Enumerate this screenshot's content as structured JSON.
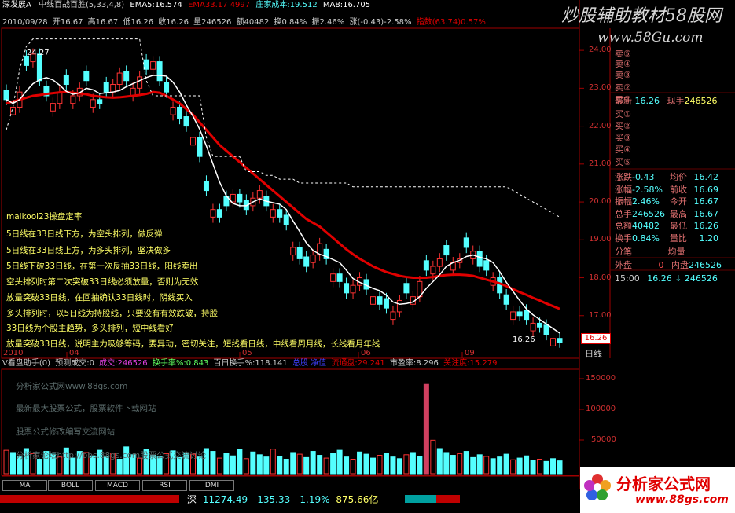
{
  "header": {
    "line1": {
      "stock": "深发展A",
      "indicator": "中线百战百胜",
      "params": "(5,33,4,8)",
      "ema5": "EMA5:16.574",
      "ema33": "EMA33.17",
      "ema33_tail": "4997",
      "dealer_cost": "庄家成本:19.512",
      "ma8": "MA8:16.705"
    },
    "line2": {
      "date": "2010/09/28",
      "open": "开16.67",
      "high": "高16.67",
      "low": "低16.26",
      "close": "收16.26",
      "volume": "量246526",
      "amount": "额40482",
      "turnover": "换0.84%",
      "amplitude": "振2.46%",
      "change": "涨(-0.43)-2.58%",
      "index": "指数(63.74)0.57%"
    }
  },
  "watermark_top": {
    "title": "炒股辅助教材58股网",
    "url": "www.58Gu.com"
  },
  "annotations": {
    "high_label": "24.27",
    "low_label": "16.26",
    "notes": [
      "maikool23操盘定率",
      "5日线在33日线下方，为空头排列，做反弹",
      "5日线在33日线上方，为多头排列，坚决做多",
      "5日线下破33日线，在第一次反抽33日线，阳线卖出",
      "空头排列时第二次突破33日线必须放量，否则为无效",
      "放量突破33日线，在回抽确认33日线时，阴线买入",
      "多头排列时，以5日线为持股线，只要没有有效跌破，持股",
      "33日线为个股主趋势，多头排列，短中线看好",
      "放量突破33日线，说明主力吸够筹码，要异动，密切关注，短线看日线，中线看周月线，长线看月年线"
    ]
  },
  "price_axis": [
    "24.00",
    "23.00",
    "22.00",
    "21.00",
    "20.00",
    "19.00",
    "18.00",
    "17.00"
  ],
  "current_price_tag": "16.26",
  "x_axis": [
    "2010",
    "04",
    "05",
    "06",
    "09"
  ],
  "period": "日线",
  "order_book": {
    "asks": [
      "卖④",
      "卖③",
      "卖②",
      "卖①"
    ],
    "ask5": "卖⑤",
    "latest_label": "最新",
    "latest_value": "16.26",
    "current_hand_label": "现手",
    "current_hand_value": "246526",
    "bids": [
      "买①",
      "买②",
      "买③",
      "买④",
      "买⑤"
    ],
    "stats": [
      {
        "l1": "涨跌",
        "v1": "-0.43",
        "l2": "均价",
        "v2": "16.42"
      },
      {
        "l1": "涨幅",
        "v1": "-2.58%",
        "l2": "前收",
        "v2": "16.69"
      },
      {
        "l1": "振幅",
        "v1": "2.46%",
        "l2": "今开",
        "v2": "16.67"
      },
      {
        "l1": "总手",
        "v1": "246526",
        "l2": "最高",
        "v2": "16.67"
      },
      {
        "l1": "总额",
        "v1": "40482",
        "l2": "最低",
        "v2": "16.26"
      },
      {
        "l1": "换手",
        "v1": "0.84%",
        "l2": "量比",
        "v2": "1.20"
      }
    ],
    "row_fenbi": "分笔",
    "row_junliang": "均量",
    "outer_label": "外盘",
    "outer_value": "0",
    "inner_label": "内盘",
    "inner_value": "246526",
    "trade_time": "15:00",
    "trade_price": "16.26",
    "trade_arrow": "↓",
    "trade_vol": "246526"
  },
  "volume_header": {
    "name": "V看盘助手(0)",
    "predict": "预测成交:0",
    "turnover": "成交:246526",
    "turnover_rate": "换手率%:0.843",
    "hundred_day": "百日换手%:118.141",
    "float_cap": "流通盘:29.241",
    "pe": "市盈率:8.296",
    "attention": "关注度:15.279",
    "label_a": "总股",
    "label_b": "净值"
  },
  "volume_axis": [
    "150000",
    "100000",
    "50000"
  ],
  "volume_watermarks": [
    "分析家公式网www.88gs.com",
    "最新最大股票公式，股票软件下载网站",
    "股票公式修改编写交流网站",
    "分析家论坛http://bbs.88gs.com股票公式交流讨论"
  ],
  "tabs": [
    "MA",
    "BOLL",
    "MACD",
    "RSI",
    "DMI"
  ],
  "status_bar": {
    "market": "深",
    "index_value": "11274.49",
    "change": "-135.33",
    "pct": "-1.19%",
    "amount": "875.66亿"
  },
  "logo": {
    "text": "分析家公式网",
    "url": "www.88gs.com"
  },
  "colors": {
    "up": "#ff3333",
    "down": "#54ffff",
    "ma33": "#e00000",
    "axis": "#a00000",
    "yellow": "#ffff66"
  },
  "chart_data": {
    "type": "candlestick",
    "ylim": [
      16.0,
      24.5
    ],
    "ticks": [
      24,
      23,
      22,
      21,
      20,
      19,
      18,
      17
    ],
    "closes": [
      22.7,
      22.5,
      22.9,
      23.6,
      23.9,
      23.2,
      22.8,
      22.6,
      22.9,
      23.1,
      22.8,
      23.0,
      23.2,
      22.7,
      22.6,
      22.9,
      23.1,
      23.4,
      23.2,
      23.0,
      23.3,
      23.5,
      23.7,
      23.2,
      22.9,
      22.5,
      22.2,
      22.0,
      21.7,
      21.2,
      20.3,
      19.8,
      19.6,
      19.9,
      20.2,
      20.0,
      19.8,
      20.1,
      20.3,
      19.9,
      19.8,
      19.6,
      19.4,
      18.8,
      18.5,
      18.3,
      18.6,
      18.9,
      18.5,
      18.1,
      17.9,
      17.6,
      17.8,
      18.0,
      17.7,
      17.5,
      17.3,
      17.2,
      17.1,
      17.4,
      17.6,
      17.5,
      17.9,
      18.2,
      18.3,
      18.5,
      18.6,
      18.4,
      18.5,
      18.8,
      18.7,
      18.3,
      18.2,
      18.0,
      17.6,
      17.3,
      17.1,
      17.0,
      16.9,
      16.8,
      16.7,
      16.5,
      16.4,
      16.3
    ],
    "ma33": [
      22.6,
      22.65,
      22.7,
      22.75,
      22.8,
      22.82,
      22.85,
      22.87,
      22.89,
      22.9,
      22.88,
      22.86,
      22.84,
      22.8,
      22.78,
      22.76,
      22.75,
      22.76,
      22.78,
      22.8,
      22.82,
      22.85,
      22.9,
      22.88,
      22.8,
      22.7,
      22.6,
      22.45,
      22.3,
      22.1,
      21.9,
      21.7,
      21.5,
      21.35,
      21.2,
      21.05,
      20.9,
      20.75,
      20.6,
      20.45,
      20.3,
      20.15,
      20.0,
      19.85,
      19.7,
      19.55,
      19.45,
      19.35,
      19.2,
      19.05,
      18.9,
      18.75,
      18.62,
      18.5,
      18.4,
      18.3,
      18.22,
      18.15,
      18.1,
      18.05,
      18.02,
      18.0,
      18.0,
      18.0,
      18.02,
      18.05,
      18.07,
      18.08,
      18.08,
      18.07,
      18.05,
      18.0,
      17.95,
      17.9,
      17.85,
      17.78,
      17.7,
      17.62,
      17.55,
      17.47,
      17.4,
      17.32,
      17.25,
      17.18
    ],
    "dealer_cost": [
      21.9,
      22.5,
      23.5,
      24.1,
      24.3,
      24.3,
      24.3,
      24.3,
      24.3,
      24.3,
      24.3,
      24.3,
      24.3,
      24.3,
      24.3,
      24.3,
      24.3,
      24.3,
      24.3,
      24.3,
      24.3,
      23.2,
      22.8,
      22.8,
      22.8,
      22.8,
      22.8,
      22.8,
      22.8,
      22.8,
      21.7,
      21.2,
      21.2,
      21.2,
      21.2,
      21.2,
      20.8,
      20.8,
      20.8,
      20.7,
      20.7,
      20.6,
      20.6,
      20.6,
      20.5,
      20.5,
      20.5,
      20.5,
      20.5,
      20.5,
      20.5,
      20.5,
      20.4,
      20.4,
      20.4,
      20.4,
      20.4,
      20.4,
      20.4,
      20.4,
      20.4,
      20.4,
      20.4,
      20.4,
      20.4,
      20.4,
      20.4,
      20.4,
      20.4,
      20.4,
      20.4,
      20.4,
      20.4,
      20.4,
      20.4,
      20.4,
      20.3,
      20.2,
      20.1,
      20.0,
      19.9,
      19.8,
      19.7,
      19.6
    ],
    "volume": [
      42000,
      38000,
      30000,
      45000,
      36000,
      26000,
      40000,
      35000,
      30000,
      46000,
      28000,
      40000,
      38000,
      32000,
      42000,
      30000,
      37000,
      26000,
      48000,
      34000,
      28000,
      44000,
      33000,
      30000,
      36000,
      41000,
      29000,
      38000,
      35000,
      30000,
      45000,
      40000,
      28000,
      36000,
      32000,
      43000,
      27000,
      39000,
      34000,
      30000,
      44000,
      31000,
      26000,
      38000,
      35000,
      29000,
      40000,
      33000,
      28000,
      37000,
      42000,
      30000,
      26000,
      39000,
      35000,
      28000,
      33000,
      36000,
      30000,
      27000,
      34000,
      38000,
      31000,
      160000,
      60000,
      45000,
      38000,
      33000,
      36000,
      40000,
      29000,
      34000,
      31000,
      27000,
      30000,
      35000,
      25000,
      28000,
      32000,
      24000,
      26000,
      22000,
      27000,
      23000
    ],
    "volume_ylim": [
      0,
      180000
    ]
  }
}
